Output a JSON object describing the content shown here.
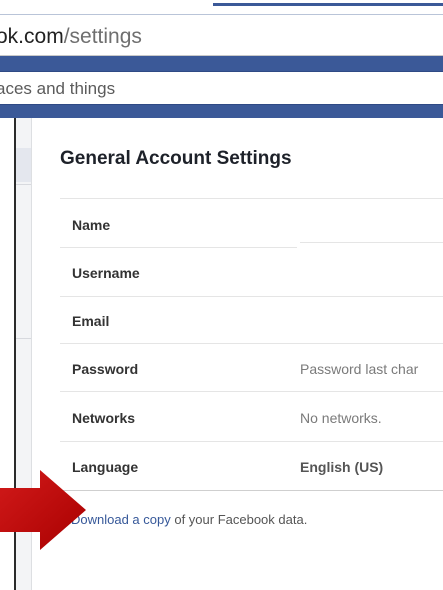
{
  "browser": {
    "url_host": "ok.com",
    "url_path": "/settings"
  },
  "search": {
    "value": "aces and things"
  },
  "settings": {
    "title": "General Account Settings",
    "rows": [
      {
        "label": "Name",
        "value": ""
      },
      {
        "label": "Username",
        "value": ""
      },
      {
        "label": "Email",
        "value": ""
      },
      {
        "label": "Password",
        "value": "Password last char"
      },
      {
        "label": "Networks",
        "value": "No networks."
      },
      {
        "label": "Language",
        "value": "English (US)"
      }
    ],
    "download_link": "Download a copy",
    "download_rest": " of your Facebook data."
  },
  "colors": {
    "brand": "#3b5998",
    "link": "#365899",
    "arrow": "#c00000"
  },
  "icons": [
    "red-arrow-icon"
  ]
}
